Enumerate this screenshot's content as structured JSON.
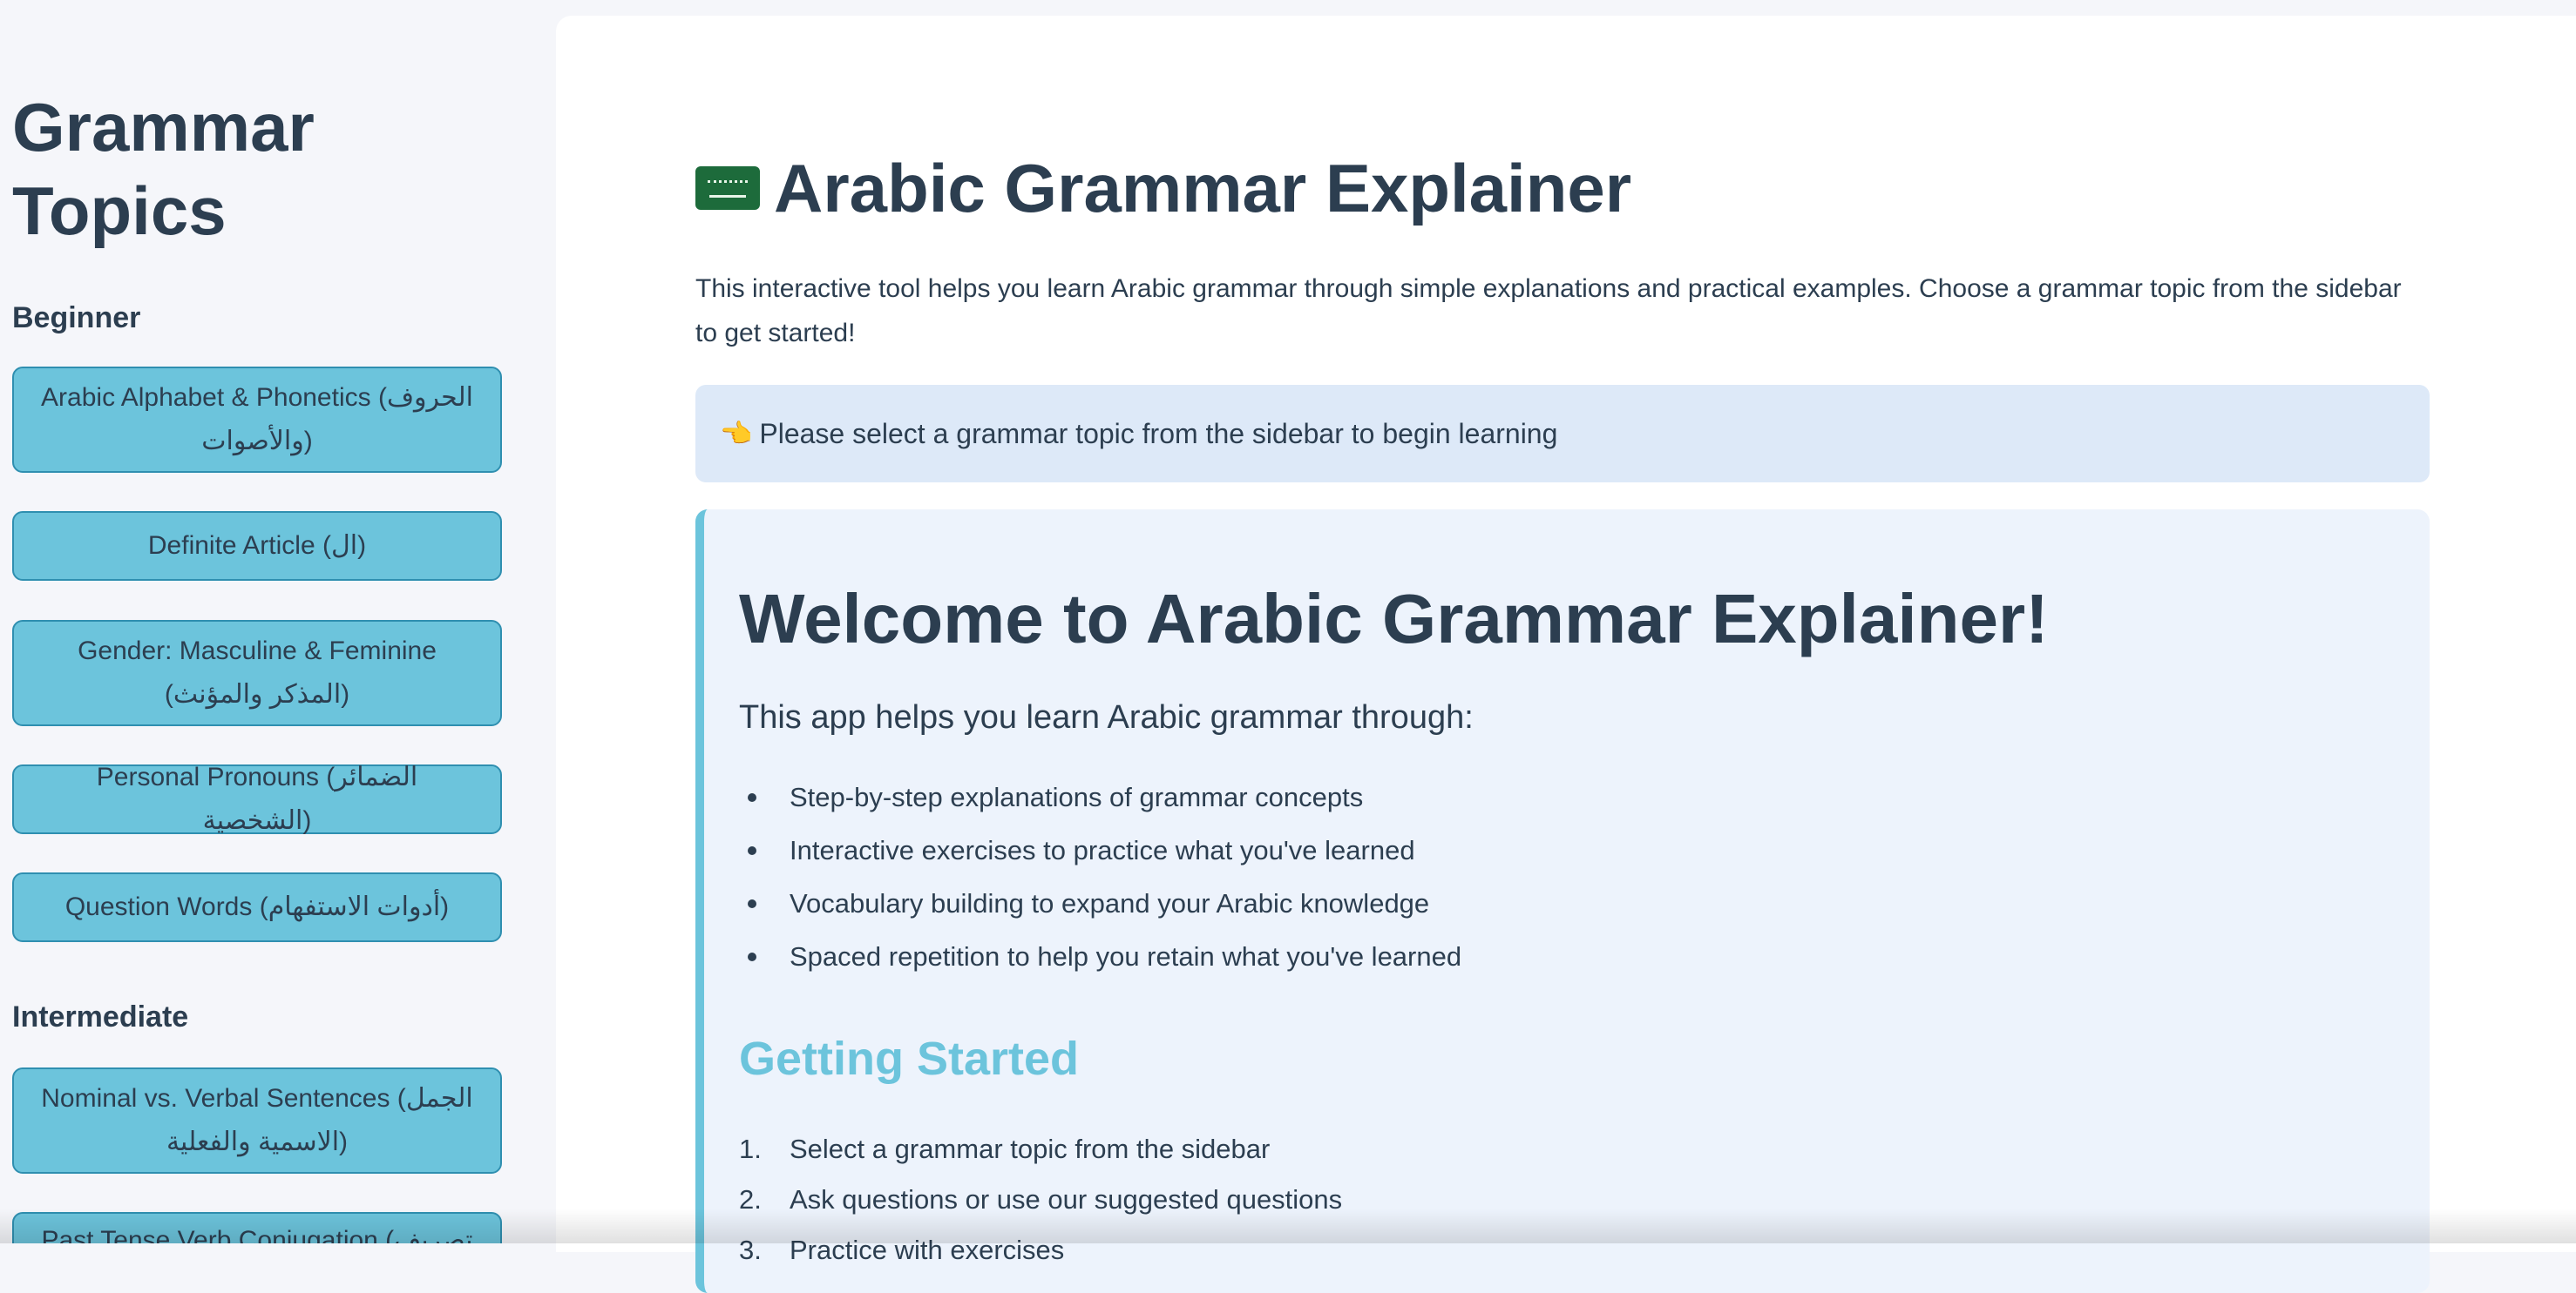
{
  "sidebar": {
    "title": "Grammar Topics",
    "sections": [
      {
        "label": "Beginner",
        "topics": [
          "Arabic Alphabet & Phonetics (الحروف والأصوات)",
          "Definite Article (ال)",
          "Gender: Masculine & Feminine (المذكر والمؤنث)",
          "Personal Pronouns (الضمائر الشخصية)",
          "Question Words (أدوات الاستفهام)"
        ]
      },
      {
        "label": "Intermediate",
        "topics": [
          "Nominal vs. Verbal Sentences (الجمل الاسمية والفعلية)",
          "Past Tense Verb Conjugation (تصريف"
        ]
      }
    ]
  },
  "main": {
    "title": "Arabic Grammar Explainer",
    "flag_icon": "saudi-flag-icon",
    "intro": "This interactive tool helps you learn Arabic grammar through simple explanations and practical examples. Choose a grammar topic from the sidebar to get started!",
    "info": {
      "icon": "👈",
      "text": "Please select a grammar topic from the sidebar to begin learning"
    },
    "welcome": {
      "title": "Welcome to Arabic Grammar Explainer!",
      "subtitle": "This app helps you learn Arabic grammar through:",
      "bullets": [
        "Step-by-step explanations of grammar concepts",
        "Interactive exercises to practice what you've learned",
        "Vocabulary building to expand your Arabic knowledge",
        "Spaced repetition to help you retain what you've learned"
      ],
      "getting_started": "Getting Started",
      "steps": [
        "Select a grammar topic from the sidebar",
        "Ask questions or use our suggested questions",
        "Practice with exercises"
      ],
      "step_numbers": [
        "1.",
        "2.",
        "3."
      ]
    }
  },
  "colors": {
    "accent": "#6cc4dc",
    "button_border": "#2f8fb0",
    "text": "#2c3e50",
    "info_bg": "#dde9f8",
    "card_bg": "#edf3fc"
  }
}
